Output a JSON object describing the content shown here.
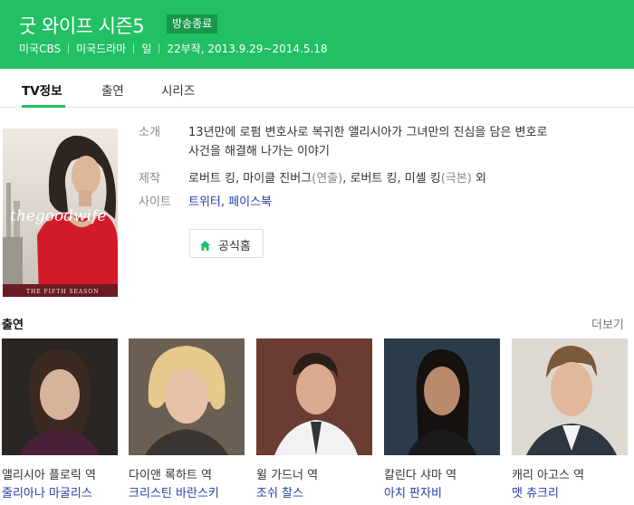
{
  "header": {
    "title": "굿 와이프 시즌5",
    "badge": "방송종료",
    "meta": [
      "미국CBS",
      "미국드라마",
      "일",
      "22부작, 2013.9.29~2014.5.18"
    ]
  },
  "tabs": [
    {
      "label": "TV정보",
      "active": true
    },
    {
      "label": "출연",
      "active": false
    },
    {
      "label": "시리즈",
      "active": false
    }
  ],
  "poster": {
    "title_text": "thegoodwife",
    "season_text": "THE FIFTH SEASON"
  },
  "info": {
    "intro_label": "소개",
    "intro_line1": "13년만에 로펌 변호사로 복귀한 앨리시아가 그녀만의 진심을 담은 변호로",
    "intro_line2": "사건을 해결해 나가는 이야기",
    "production_label": "제작",
    "production_a": "로버트 킹, 마이클 진버그",
    "production_a_role": "(연출)",
    "production_b": ", 로버트 킹, 미셸 킹",
    "production_b_role": "(극본)",
    "production_suffix": " 외",
    "site_label": "사이트",
    "site_links": "트위터, 페이스북"
  },
  "home_button": {
    "label": "공식홈"
  },
  "cast_section": {
    "title": "출연",
    "more": "더보기",
    "members": [
      {
        "role": "앨리시아 플로릭 역",
        "actor": "줄리아나 마굴리스"
      },
      {
        "role": "다이앤 록하트 역",
        "actor": "크리스틴 바란스키"
      },
      {
        "role": "윌 가드너 역",
        "actor": "조쉬 찰스"
      },
      {
        "role": "칼린다 샤마 역",
        "actor": "아치 판자비"
      },
      {
        "role": "캐리 아고스 역",
        "actor": "맷 츄크리"
      }
    ]
  },
  "colors": {
    "brand_green": "#21c063",
    "badge_green": "#17974c",
    "link_blue": "#2140a8"
  },
  "icons": {
    "home_button_icon": "home-icon"
  }
}
